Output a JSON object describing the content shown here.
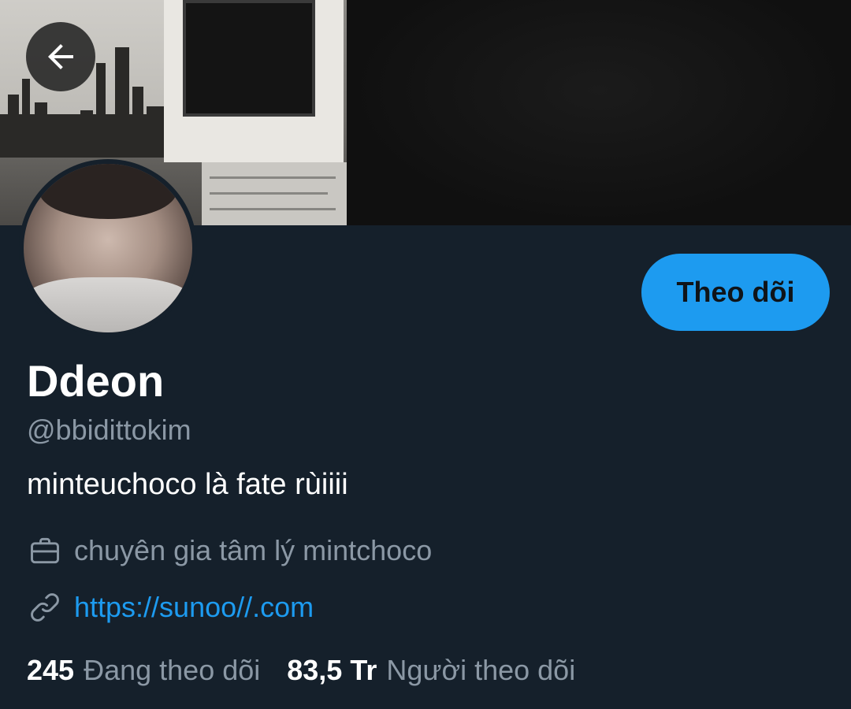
{
  "profile": {
    "display_name": "Ddeon",
    "handle": "@bbidittokim",
    "bio": "minteuchoco là fate rùiiii",
    "profession": "chuyên gia tâm lý mintchoco",
    "website": "https://sunoo//.com"
  },
  "actions": {
    "follow_label": "Theo dõi"
  },
  "stats": {
    "following_count": "245",
    "following_label": "Đang theo dõi",
    "followers_count": "83,5 Tr",
    "followers_label": "Người theo dõi"
  },
  "icons": {
    "back": "arrow-left-icon",
    "profession": "briefcase-icon",
    "website": "link-icon"
  },
  "colors": {
    "background": "#15202b",
    "accent": "#1d9bf0",
    "primary_text": "#ffffff",
    "secondary_text": "#8b98a5"
  }
}
